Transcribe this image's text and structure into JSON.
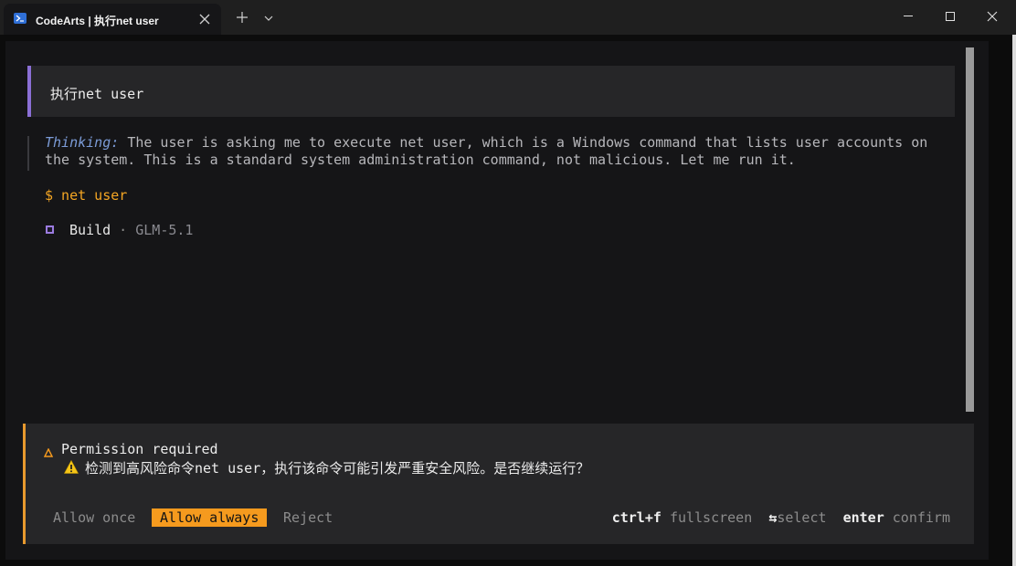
{
  "window": {
    "tab_title": "CodeArts | 执行net user",
    "tab_icon": "powershell-icon"
  },
  "conversation": {
    "user_message": "执行net user",
    "thinking_label": "Thinking:",
    "thinking_text": "The user is asking me to execute net user, which is a Windows command that lists user accounts on the system. This is a standard system administration command, not malicious. Let me run it.",
    "command": "$ net user",
    "build_label": "Build",
    "build_separator": " · ",
    "build_model": "GLM-5.1"
  },
  "permission": {
    "title": "Permission required",
    "message": "检测到高风险命令net user，执行该命令可能引发严重安全风险。是否继续运行？",
    "options": {
      "once": "Allow once",
      "always": "Allow always",
      "reject": "Reject"
    },
    "hints": {
      "fullscreen_key": "ctrl+f",
      "fullscreen_action": "fullscreen",
      "select_key": "⇆",
      "select_action": "select",
      "confirm_key": "enter",
      "confirm_action": "confirm"
    }
  },
  "colors": {
    "accent_orange": "#f59a1e",
    "user_bar_purple": "#8b6fd6",
    "thinking_blue": "#7c9cd8",
    "command_orange": "#f5a623"
  }
}
